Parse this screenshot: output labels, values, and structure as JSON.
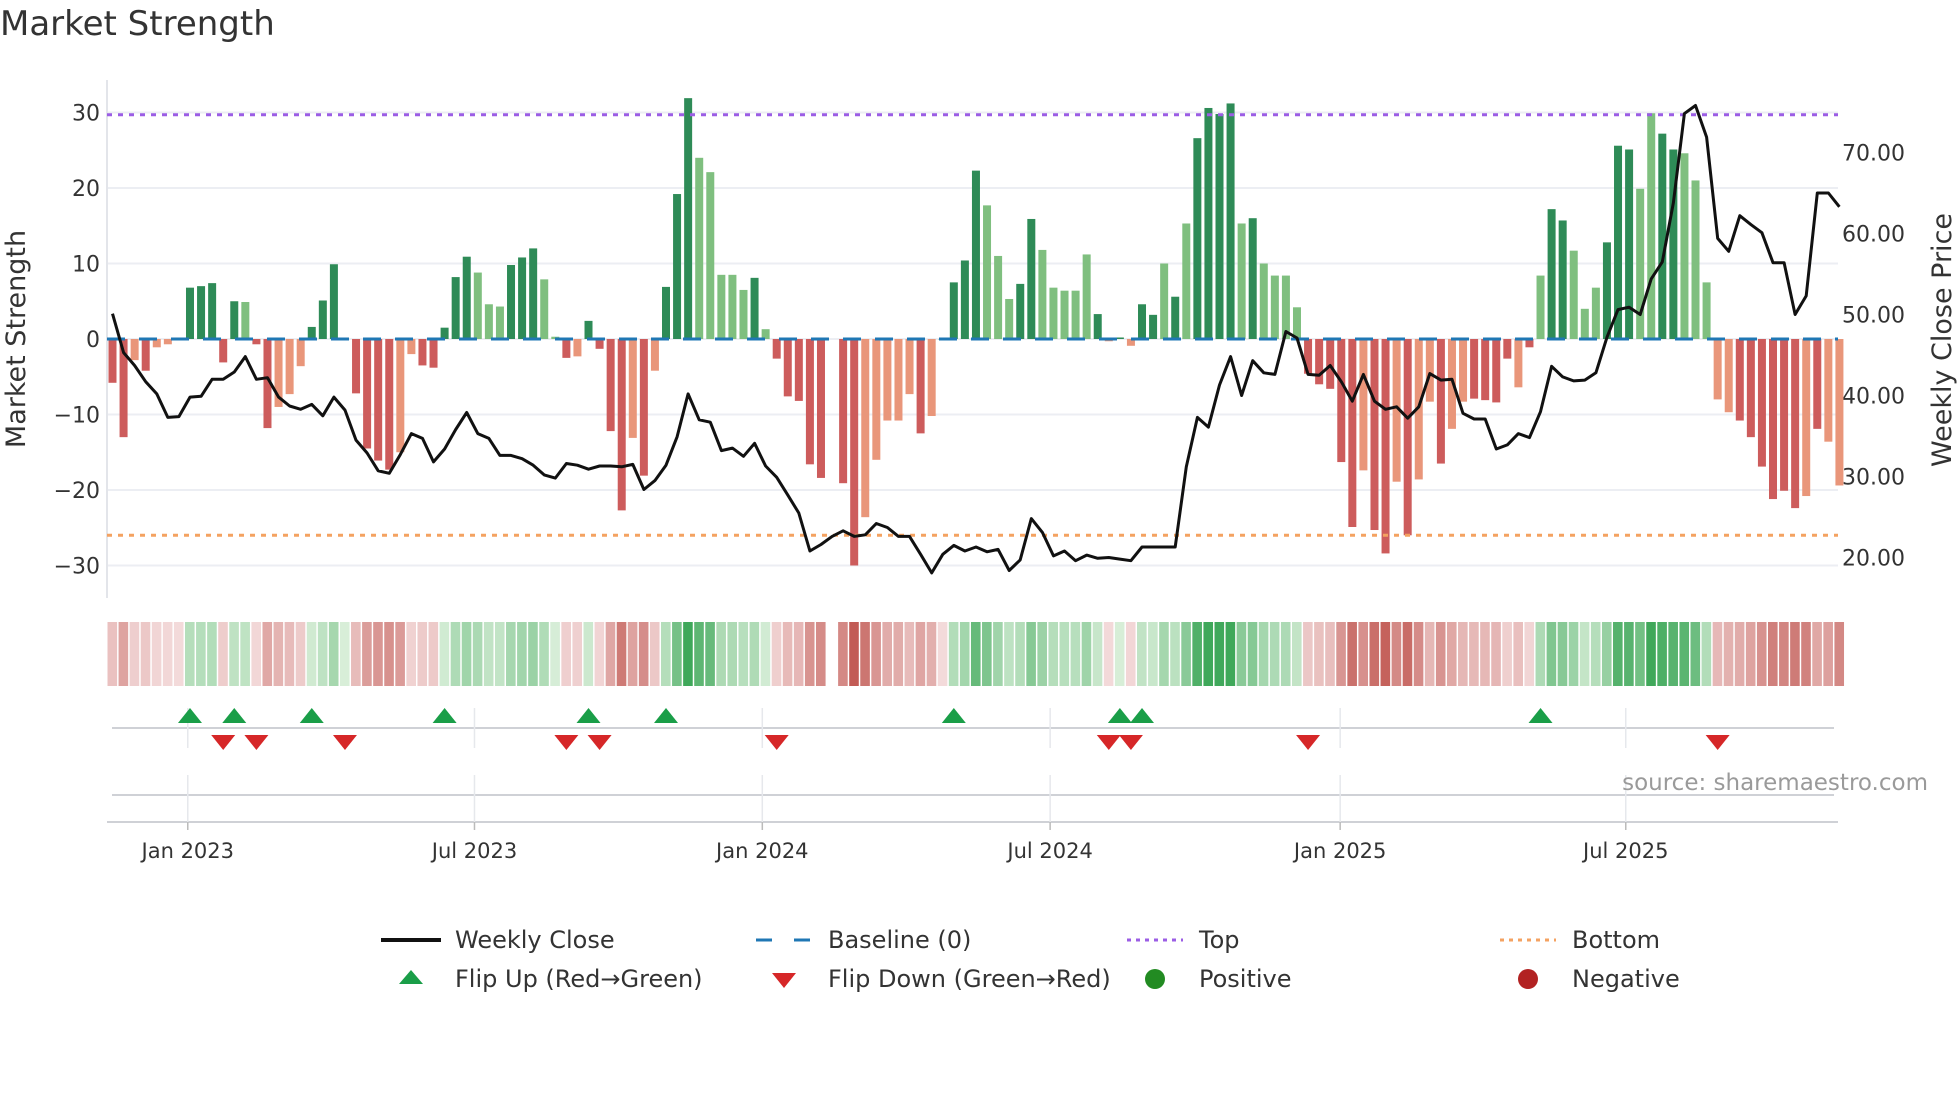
{
  "title": "Market Strength",
  "source": "source: sharemaestro.com",
  "colors": {
    "strong_green": "#2e8b57",
    "weak_green": "#7fbf7f",
    "strong_red": "#cd5c5c",
    "weak_red": "#e9967a",
    "baseline": "#1f77b4",
    "top": "#9b5de5",
    "bottom": "#f4a261",
    "close": "#111111",
    "flip_up": "#1a9e48",
    "flip_down": "#d62728",
    "positive": "#228b22",
    "negative": "#b22222"
  },
  "legend": [
    {
      "label": "Weekly Close",
      "icon": "line-solid-icon"
    },
    {
      "label": "Baseline (0)",
      "icon": "line-dashed-icon"
    },
    {
      "label": "Top",
      "icon": "line-dotted-purple-icon"
    },
    {
      "label": "Bottom",
      "icon": "line-dotted-orange-icon"
    },
    {
      "label": "Flip Up (Red→Green)",
      "icon": "triangle-up-icon"
    },
    {
      "label": "Flip Down (Green→Red)",
      "icon": "triangle-down-icon"
    },
    {
      "label": "Positive",
      "icon": "circle-green-icon"
    },
    {
      "label": "Negative",
      "icon": "circle-red-icon"
    }
  ],
  "chart_data": {
    "type": "bar",
    "title": "Market Strength",
    "ylabel": "Market Strength",
    "y2label": "Weekly Close Price",
    "xunit": "week index",
    "ylim": [
      -34.3,
      34.3
    ],
    "y2lim": [
      15,
      79
    ],
    "yticks": [
      "30",
      "20",
      "10",
      "0",
      "−10",
      "−20",
      "−30"
    ],
    "ytick_values": [
      30,
      20,
      10,
      0,
      -10,
      -20,
      -30
    ],
    "y2ticks": [
      "70.00",
      "60.00",
      "50.00",
      "40.00",
      "30.00",
      "20.00"
    ],
    "y2tick_values": [
      70,
      60,
      50,
      40,
      30,
      20
    ],
    "xticks": [
      {
        "label": "Jan 2023",
        "week": 6.8
      },
      {
        "label": "Jul 2023",
        "week": 32.7
      },
      {
        "label": "Jan 2024",
        "week": 58.7
      },
      {
        "label": "Jul 2024",
        "week": 84.7
      },
      {
        "label": "Jan 2025",
        "week": 110.9
      },
      {
        "label": "Jul 2025",
        "week": 136.7
      }
    ],
    "top_level": 29.7,
    "bottom_level": -26.0,
    "baseline": 0,
    "strength": [
      -5.8,
      -13,
      -2.8,
      -4.2,
      -1.1,
      -0.7,
      0,
      6.8,
      7.0,
      7.4,
      -3.1,
      5.0,
      4.9,
      -0.7,
      -11.8,
      -9.0,
      -7.3,
      -3.6,
      1.6,
      5.1,
      9.9,
      0,
      -7.2,
      -14.5,
      -16.1,
      -17.3,
      -15.0,
      -2.0,
      -3.5,
      -3.8,
      1.5,
      8.2,
      10.9,
      8.8,
      4.6,
      4.3,
      9.8,
      10.8,
      12.0,
      7.9,
      0.3,
      -2.5,
      -2.3,
      2.4,
      -1.3,
      -12.2,
      -22.7,
      -13.1,
      -18.1,
      -4.2,
      6.9,
      19.2,
      31.9,
      24.0,
      22.1,
      8.5,
      8.5,
      6.5,
      8.1,
      1.3,
      -2.6,
      -7.6,
      -8.2,
      -16.6,
      -18.4,
      null,
      -19.1,
      -30.0,
      -23.6,
      -16.0,
      -10.8,
      -10.8,
      -7.3,
      -12.5,
      -10.2,
      0,
      7.5,
      10.4,
      22.3,
      17.7,
      11.0,
      5.3,
      7.3,
      15.9,
      11.8,
      6.8,
      6.4,
      6.4,
      11.2,
      3.3,
      -0.3,
      0.2,
      -0.9,
      4.6,
      3.2,
      10.0,
      5.6,
      15.3,
      26.6,
      30.6,
      29.8,
      31.2,
      15.3,
      16.0,
      10.0,
      8.4,
      8.4,
      4.2,
      -4.6,
      -6.0,
      -6.6,
      -16.3,
      -24.9,
      -17.4,
      -25.3,
      -28.4,
      -18.9,
      -26.0,
      -18.6,
      -8.3,
      -16.5,
      -11.9,
      -8.3,
      -7.9,
      -8.1,
      -8.4,
      -2.6,
      -6.4,
      -1.1,
      8.4,
      17.2,
      15.7,
      11.7,
      4.0,
      6.8,
      12.8,
      25.6,
      25.1,
      19.9,
      29.9,
      27.2,
      25.1,
      24.6,
      21.0,
      7.5,
      -8.0,
      -9.7,
      -10.8,
      -13.0,
      -16.9,
      -21.2,
      -20.1,
      -22.4,
      -20.8,
      -11.9,
      -13.6,
      -19.4
    ],
    "tone": "ddldllddddddlddlllddddddddlldddddllldddlldlddddldldddllllldlddddd-ddllllldlddddlllddllllldldlddldlddddldlllldddddlddldlldllddddldlddllldddllddlllllddddddldlldd",
    "weekly_close": [
      50.1,
      45.3,
      43.7,
      41.7,
      40.2,
      37.3,
      37.4,
      39.8,
      39.9,
      42.0,
      42.0,
      42.9,
      44.8,
      42.0,
      42.2,
      39.8,
      38.7,
      38.3,
      38.9,
      37.5,
      39.8,
      38.2,
      34.5,
      32.9,
      30.7,
      30.4,
      32.7,
      35.3,
      34.7,
      31.8,
      33.4,
      35.8,
      37.9,
      35.3,
      34.7,
      32.6,
      32.6,
      32.2,
      31.4,
      30.2,
      29.8,
      31.6,
      31.4,
      30.9,
      31.3,
      31.3,
      31.2,
      31.5,
      28.4,
      29.5,
      31.4,
      34.9,
      40.2,
      37.0,
      36.7,
      33.2,
      33.5,
      32.5,
      34.1,
      31.3,
      29.9,
      27.7,
      25.5,
      20.8,
      21.6,
      22.6,
      23.3,
      22.6,
      22.8,
      24.2,
      23.7,
      22.6,
      22.6,
      20.4,
      18.1,
      20.4,
      21.5,
      20.8,
      21.3,
      20.7,
      21.0,
      18.4,
      19.7,
      24.8,
      23.1,
      20.2,
      20.8,
      19.6,
      20.3,
      19.9,
      20.0,
      19.8,
      19.6,
      21.3,
      21.3,
      21.3,
      21.3,
      31.2,
      37.3,
      36.1,
      41.3,
      44.8,
      40.0,
      44.3,
      42.8,
      42.6,
      47.9,
      47.1,
      42.6,
      42.5,
      43.7,
      41.7,
      39.3,
      42.6,
      39.3,
      38.3,
      38.6,
      37.2,
      38.6,
      42.7,
      41.9,
      42.0,
      37.8,
      37.1,
      37.1,
      33.4,
      33.9,
      35.3,
      34.8,
      38.0,
      43.6,
      42.3,
      41.8,
      41.9,
      42.8,
      47.2,
      50.6,
      50.9,
      50.0,
      54.4,
      56.5,
      63.8,
      74.8,
      75.8,
      71.9,
      59.4,
      57.8,
      62.2,
      61.1,
      60.1,
      56.4,
      56.4,
      50.0,
      52.3,
      65.0,
      65.0,
      63.3
    ],
    "flip_up_weeks": [
      7,
      11,
      18,
      30,
      43,
      50,
      76,
      91,
      93,
      129
    ],
    "flip_down_weeks": [
      10,
      13,
      21,
      41,
      44,
      60,
      90,
      92,
      108,
      145
    ]
  }
}
